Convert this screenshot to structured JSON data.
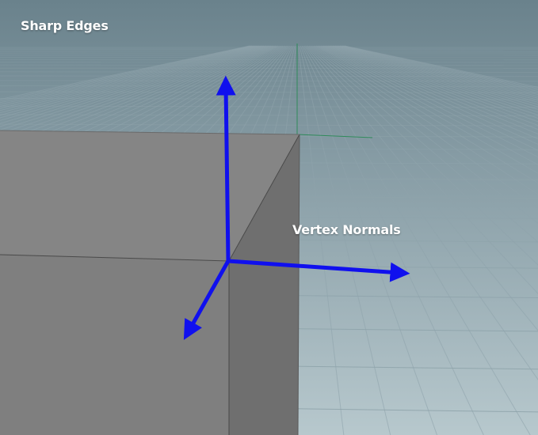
{
  "viewport": {
    "title_label": "Sharp Edges",
    "annotation_label": "Vertex Normals"
  },
  "colors": {
    "sky_top": "#6f8791",
    "sky_bottom": "#9cb0b8",
    "floor_near": "#b5c6cb",
    "grid_line": "#8ea3aa",
    "box_top": "#858585",
    "box_side_left": "#7e7e7e",
    "box_side_right": "#6e6e6e",
    "box_edge": "#4d4d4d",
    "normal_arrow": "#1010ee",
    "axis_green": "#2f8a5a"
  },
  "icons": {
    "normal_arrows": "arrow-icon"
  }
}
